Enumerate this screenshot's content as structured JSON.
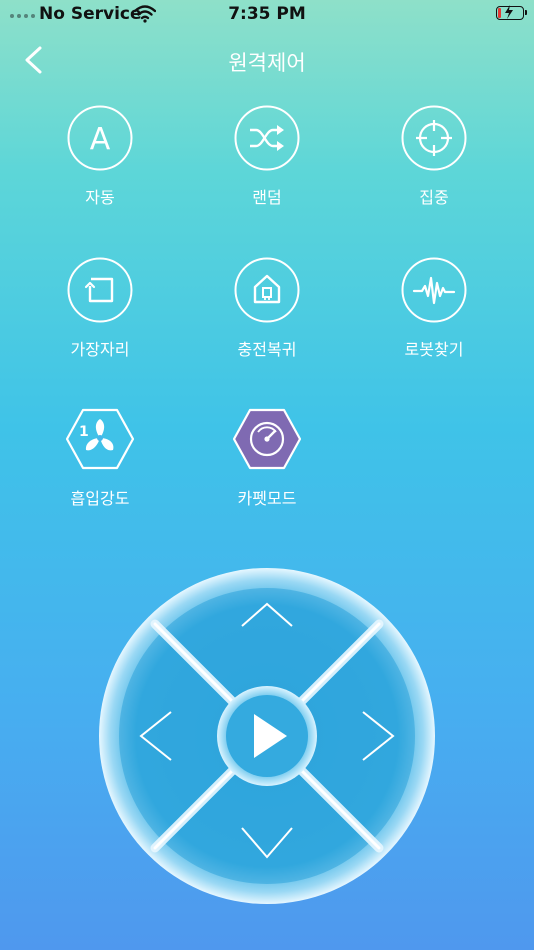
{
  "status_bar": {
    "carrier": "No Service",
    "time": "7:35 PM"
  },
  "header": {
    "title": "원격제어"
  },
  "modes": [
    {
      "label": "자동"
    },
    {
      "label": "랜덤"
    },
    {
      "label": "집중"
    },
    {
      "label": "가장자리"
    },
    {
      "label": "충전복귀"
    },
    {
      "label": "로봇찾기"
    },
    {
      "label": "흡입강도"
    },
    {
      "label": "카펫모드"
    }
  ],
  "icons": {
    "auto": "letter-a-icon",
    "random": "shuffle-icon",
    "spot": "crosshair-icon",
    "edge": "edge-icon",
    "home": "home-icon",
    "find": "waveform-icon",
    "suction": "fan-icon",
    "carpet": "gauge-icon"
  },
  "auto_icon_letter": "A",
  "suction_level": "1",
  "colors": {
    "carpet_active": "#7f6ab2",
    "battery_low": "#e53935"
  }
}
